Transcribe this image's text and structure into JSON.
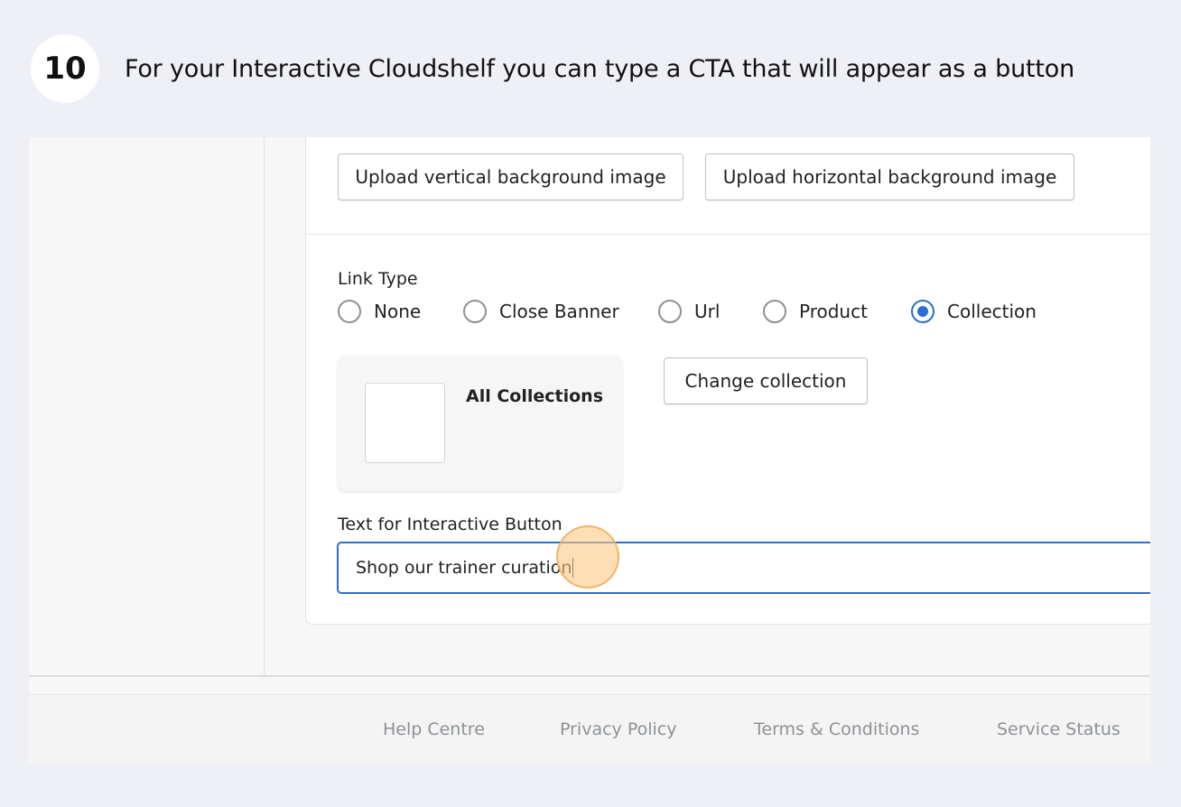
{
  "step": {
    "number": "10",
    "instruction": "For your Interactive Cloudshelf you can type a CTA that will appear as a button"
  },
  "background_buttons": {
    "vertical_label": "Upload vertical background image",
    "horizontal_label": "Upload horizontal background image"
  },
  "link_type": {
    "label": "Link Type",
    "options": [
      {
        "label": "None",
        "checked": false
      },
      {
        "label": "Close Banner",
        "checked": false
      },
      {
        "label": "Url",
        "checked": false
      },
      {
        "label": "Product",
        "checked": false
      },
      {
        "label": "Collection",
        "checked": true
      }
    ]
  },
  "collection": {
    "title": "All Collections",
    "change_label": "Change collection"
  },
  "interactive_button": {
    "label": "Text for Interactive Button",
    "value": "Shop our trainer curation"
  },
  "footer": {
    "links": [
      "Help Centre",
      "Privacy Policy",
      "Terms & Conditions",
      "Service Status"
    ]
  },
  "colors": {
    "accent": "#2c6ecb",
    "page_bg": "#eef0f5",
    "click_marker": "#fdc882"
  }
}
